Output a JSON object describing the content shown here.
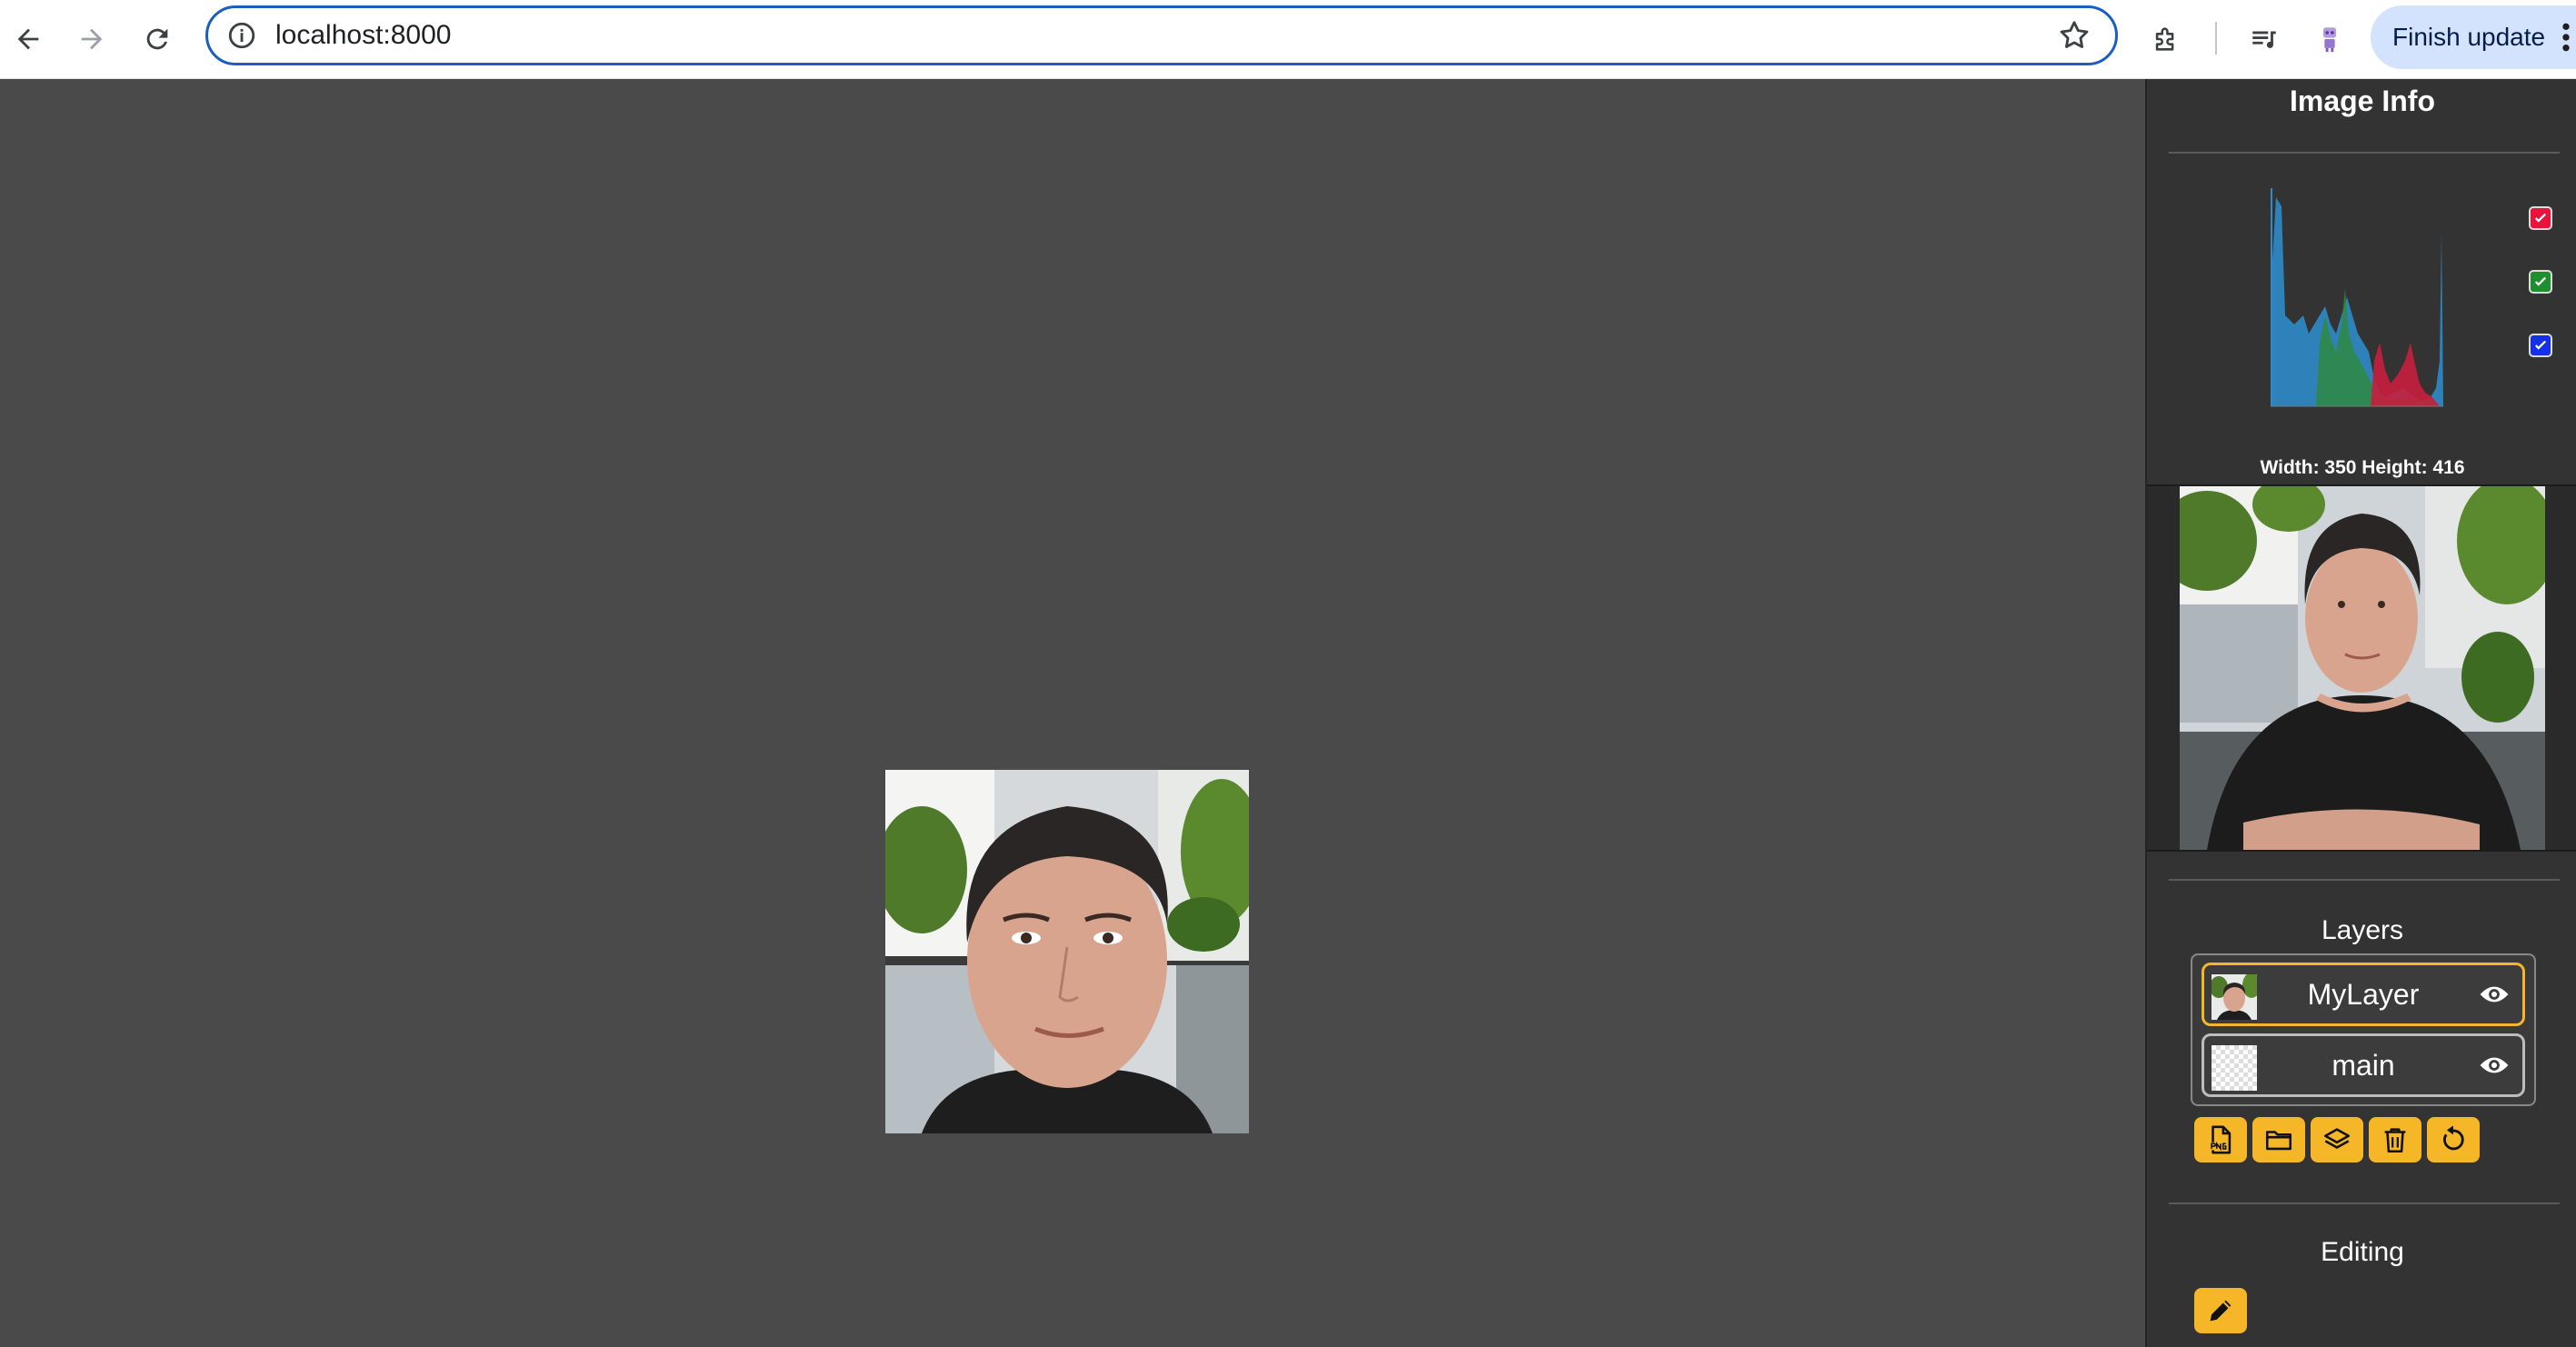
{
  "browser": {
    "url": "localhost:8000",
    "finish_update_label": "Finish update"
  },
  "panel": {
    "image_info_title": "Image Info",
    "histogram_channels": [
      "red",
      "green",
      "blue"
    ],
    "dimensions_text": "Width: 350 Height: 416",
    "layers_title": "Layers",
    "layers": [
      {
        "name": "MyLayer",
        "active": true,
        "thumbnail": "photo"
      },
      {
        "name": "main",
        "active": false,
        "thumbnail": "transparent"
      }
    ],
    "layer_actions": [
      "export-png-icon",
      "open-folder-icon",
      "layers-icon",
      "trash-icon",
      "reset-icon"
    ],
    "editing_title": "Editing",
    "editing_tools": [
      "pencil-icon"
    ]
  },
  "colors": {
    "canvas_bg": "#4a4a4a",
    "panel_bg": "#333333",
    "accent": "#f5b728",
    "omnibox_border": "#1a5fbf"
  }
}
